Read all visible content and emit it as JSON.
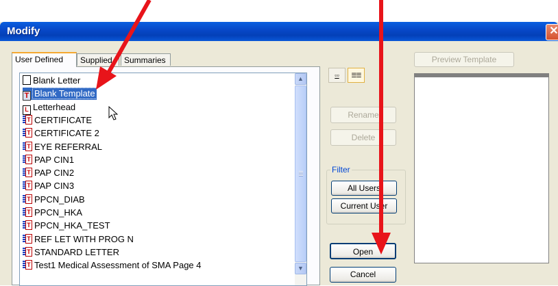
{
  "window": {
    "title": "Modify",
    "close_glyph": "✕"
  },
  "tabs": [
    {
      "label": "User Defined",
      "active": true
    },
    {
      "label": "Supplied",
      "active": false
    },
    {
      "label": "Summaries",
      "active": false
    }
  ],
  "templates": [
    {
      "label": "Blank Letter",
      "icon": "blank-document-icon",
      "selected": false
    },
    {
      "label": "Blank Template",
      "icon": "template-icon",
      "selected": true
    },
    {
      "label": "Letterhead",
      "icon": "letterhead-icon",
      "selected": false
    },
    {
      "label": "CERTIFICATE",
      "icon": "merge-template-icon",
      "selected": false
    },
    {
      "label": "CERTIFICATE 2",
      "icon": "merge-template-icon",
      "selected": false
    },
    {
      "label": "EYE REFERRAL",
      "icon": "merge-template-icon",
      "selected": false
    },
    {
      "label": "PAP CIN1",
      "icon": "merge-template-icon",
      "selected": false
    },
    {
      "label": "PAP CIN2",
      "icon": "merge-template-icon",
      "selected": false
    },
    {
      "label": "PAP CIN3",
      "icon": "merge-template-icon",
      "selected": false
    },
    {
      "label": "PPCN_DIAB",
      "icon": "merge-template-icon",
      "selected": false
    },
    {
      "label": "PPCN_HKA",
      "icon": "merge-template-icon",
      "selected": false
    },
    {
      "label": "PPCN_HKA_TEST",
      "icon": "merge-template-icon",
      "selected": false
    },
    {
      "label": "REF LET WITH PROG N",
      "icon": "merge-template-icon",
      "selected": false
    },
    {
      "label": "STANDARD LETTER",
      "icon": "merge-template-icon",
      "selected": false
    },
    {
      "label": "Test1  Medical Assessment of SMA Page 4",
      "icon": "merge-template-icon",
      "selected": false
    }
  ],
  "buttons": {
    "rename": "Rename",
    "delete": "Delete",
    "open": "Open",
    "cancel": "Cancel",
    "preview_template": "Preview Template"
  },
  "filter": {
    "label": "Filter",
    "all_users": "All Users",
    "current_user": "Current User"
  },
  "view_buttons": [
    "large-icons-view-icon",
    "details-view-icon"
  ],
  "colors": {
    "selection": "#316AC5",
    "annotation_arrow": "#E8141A",
    "title_bar": "#0848C8"
  }
}
